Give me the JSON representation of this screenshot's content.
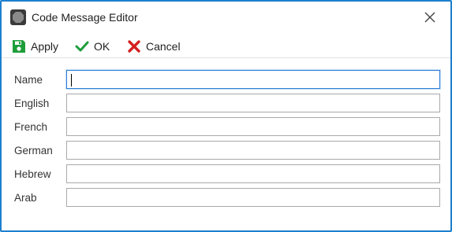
{
  "window": {
    "title": "Code Message Editor",
    "accent_color": "#1e7fd0"
  },
  "toolbar": {
    "apply_label": "Apply",
    "ok_label": "OK",
    "cancel_label": "Cancel",
    "apply_icon": "save-icon",
    "ok_icon": "check-icon",
    "cancel_icon": "x-icon",
    "apply_color": "#1e9e3a",
    "ok_color": "#1e9e3a",
    "cancel_color": "#d42020"
  },
  "form": {
    "fields": [
      {
        "label": "Name",
        "value": ""
      },
      {
        "label": "English",
        "value": ""
      },
      {
        "label": "French",
        "value": ""
      },
      {
        "label": "German",
        "value": ""
      },
      {
        "label": "Hebrew",
        "value": ""
      },
      {
        "label": "Arab",
        "value": ""
      }
    ]
  }
}
